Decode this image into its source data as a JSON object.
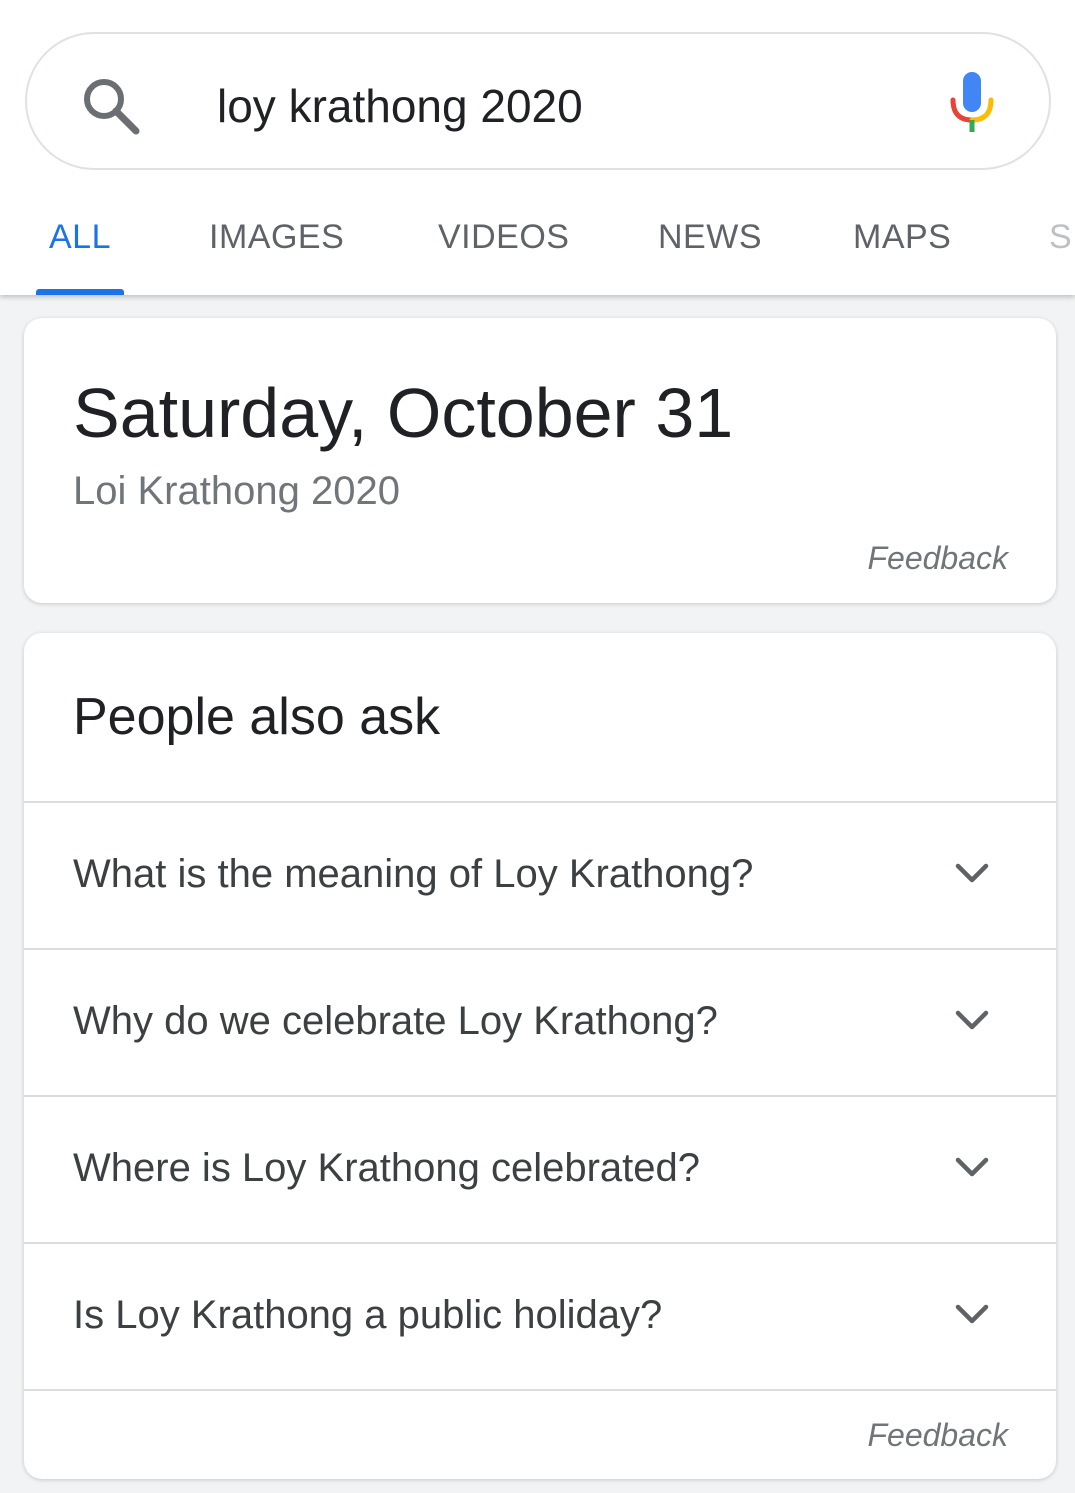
{
  "search": {
    "query": "loy krathong 2020"
  },
  "tabs": [
    {
      "label": "ALL",
      "active": true
    },
    {
      "label": "IMAGES",
      "active": false
    },
    {
      "label": "VIDEOS",
      "active": false
    },
    {
      "label": "NEWS",
      "active": false
    },
    {
      "label": "MAPS",
      "active": false
    },
    {
      "label": "S",
      "active": false
    }
  ],
  "answer_card": {
    "date": "Saturday, October 31",
    "subtitle": "Loi Krathong 2020",
    "feedback": "Feedback"
  },
  "people_also_ask": {
    "title": "People also ask",
    "questions": [
      "What is the meaning of Loy Krathong?",
      "Why do we celebrate Loy Krathong?",
      "Where is Loy Krathong celebrated?",
      "Is Loy Krathong a public holiday?"
    ],
    "feedback": "Feedback"
  },
  "colors": {
    "accent": "#1a73e8",
    "text_primary": "#202124",
    "text_secondary": "#70757a",
    "divider": "#dadce0"
  },
  "icons": {
    "search": "search-icon",
    "mic": "mic-icon",
    "expand": "chevron-down-icon"
  }
}
